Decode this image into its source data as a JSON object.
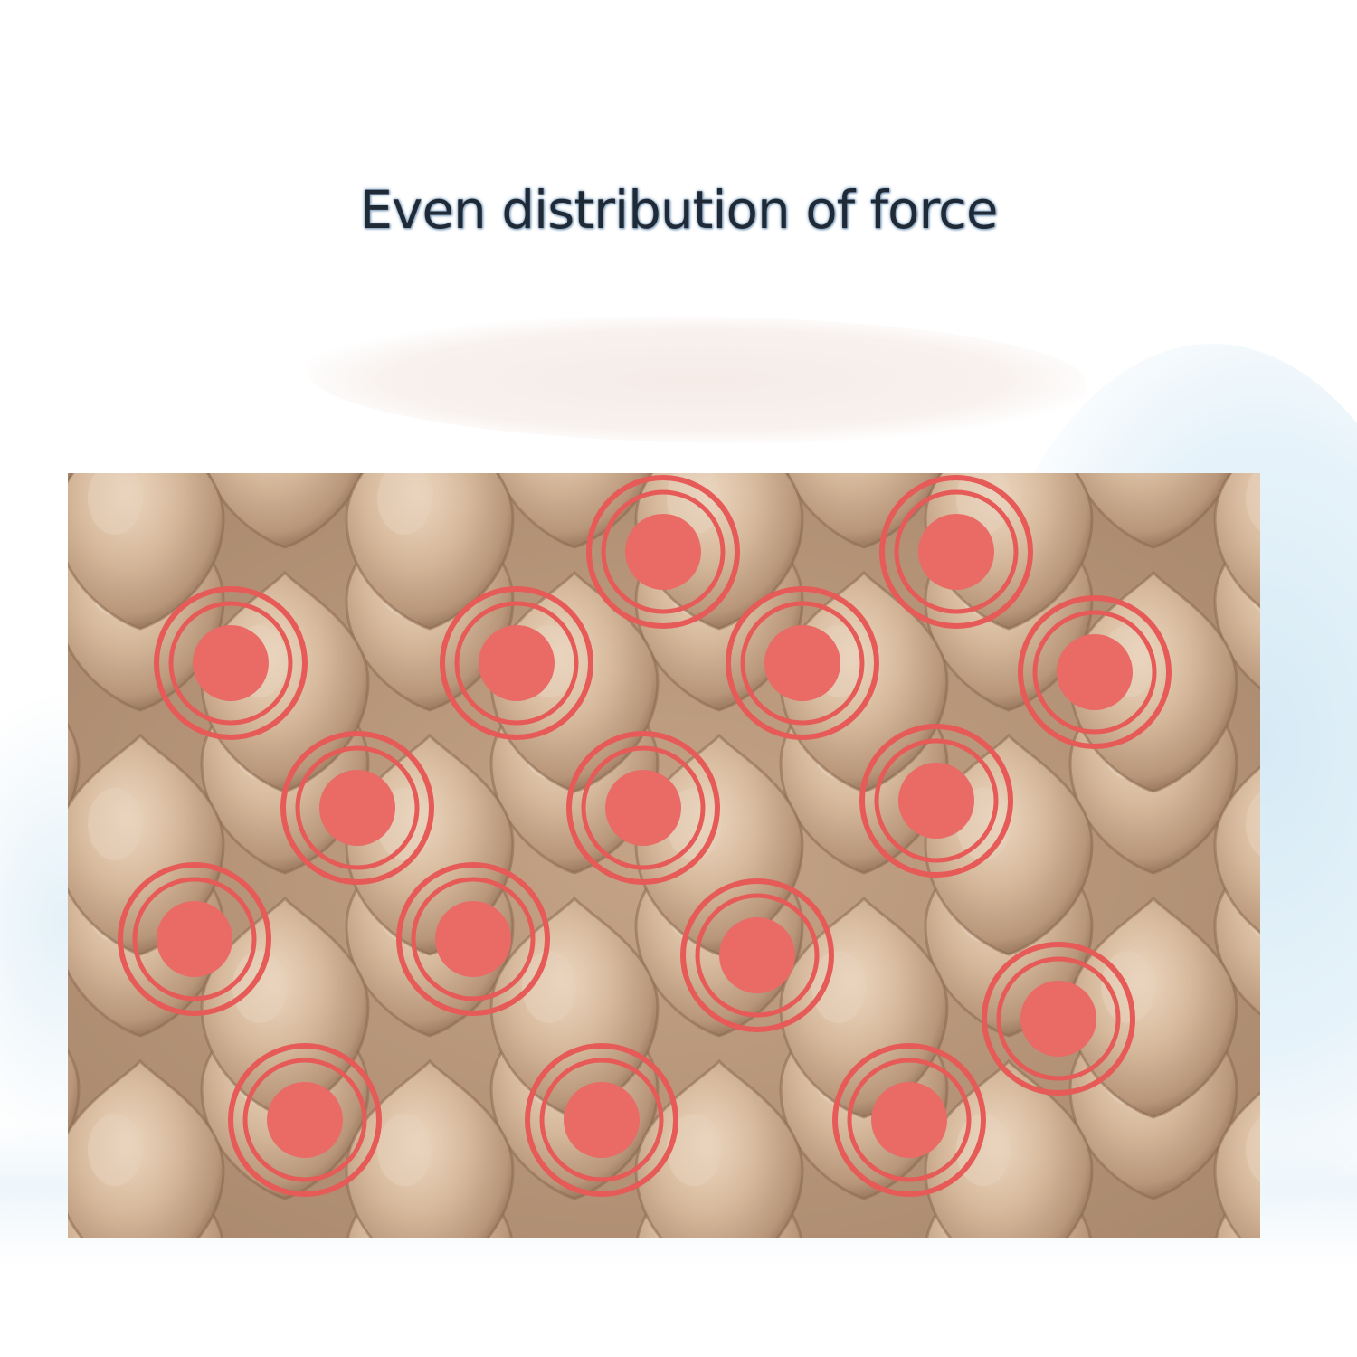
{
  "headline": {
    "text": "Even distribution of force"
  },
  "product_image": {
    "icon": "air-cell-mattress-icon",
    "marker_icon": "pressure-point-icon",
    "colors": {
      "cell_base": "#c9a98a",
      "cell_highlight": "#e8d2bb",
      "cell_shadow": "#8a6a50",
      "marker_fill": "#ea6a66",
      "marker_ring": "#e65a58"
    }
  }
}
